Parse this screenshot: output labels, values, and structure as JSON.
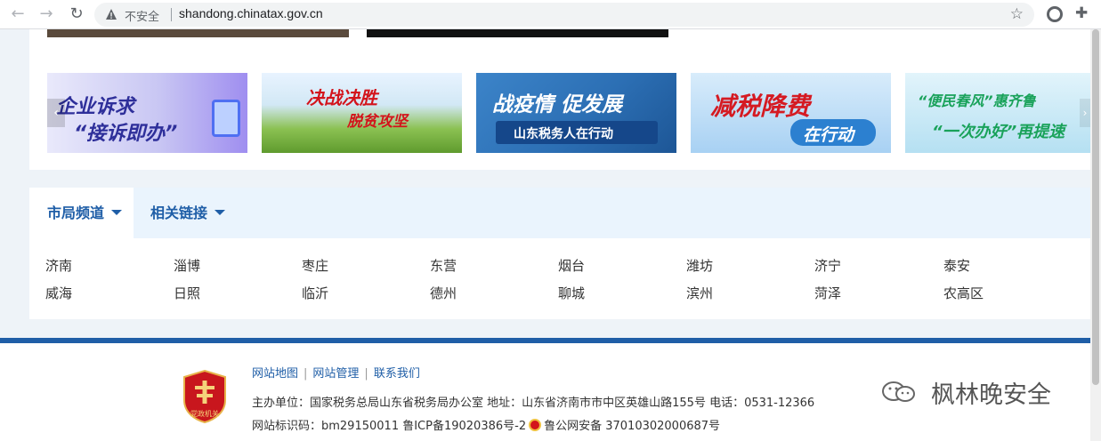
{
  "browser": {
    "security_label": "不安全",
    "url": "shandong.chinatax.gov.cn",
    "icons": [
      "back-arrow-icon",
      "forward-arrow-icon",
      "reload-icon",
      "warning-icon",
      "star-icon",
      "extension-circle-icon",
      "puzzle-icon"
    ]
  },
  "banners": [
    {
      "line1": "企业诉求",
      "line2": "“接诉即办”"
    },
    {
      "line1": "决战决胜",
      "line2": "脱贫攻坚"
    },
    {
      "line1": "战疫情 促发展",
      "line2": "山东税务人在行动"
    },
    {
      "line1": "减税降费",
      "line2": "在行动"
    },
    {
      "line1": "“便民春风”惠齐鲁",
      "line2": "“一次办好”再提速"
    }
  ],
  "tabs": {
    "city_channels": "市局频道",
    "related_links": "相关链接"
  },
  "cities": [
    "济南",
    "淄博",
    "枣庄",
    "东营",
    "烟台",
    "潍坊",
    "济宁",
    "泰安",
    "威海",
    "日照",
    "临沂",
    "德州",
    "聊城",
    "滨州",
    "菏泽",
    "农高区"
  ],
  "footer": {
    "links": [
      "网站地图",
      "网站管理",
      "联系我们"
    ],
    "host": "主办单位：国家税务总局山东省税务局办公室 地址：山东省济南市市中区英雄山路155号 电话：0531-12366",
    "site_id": "网站标识码：bm29150011 鲁ICP备19020386号-2",
    "police": "鲁公网安备 37010302000687号",
    "emblem_text": "党政机关"
  },
  "watermark": "枫林晚安全",
  "colors": {
    "brand_blue": "#1f5ea7",
    "tab_bg": "#eaf4fd",
    "page_bg": "#eef3f8"
  }
}
